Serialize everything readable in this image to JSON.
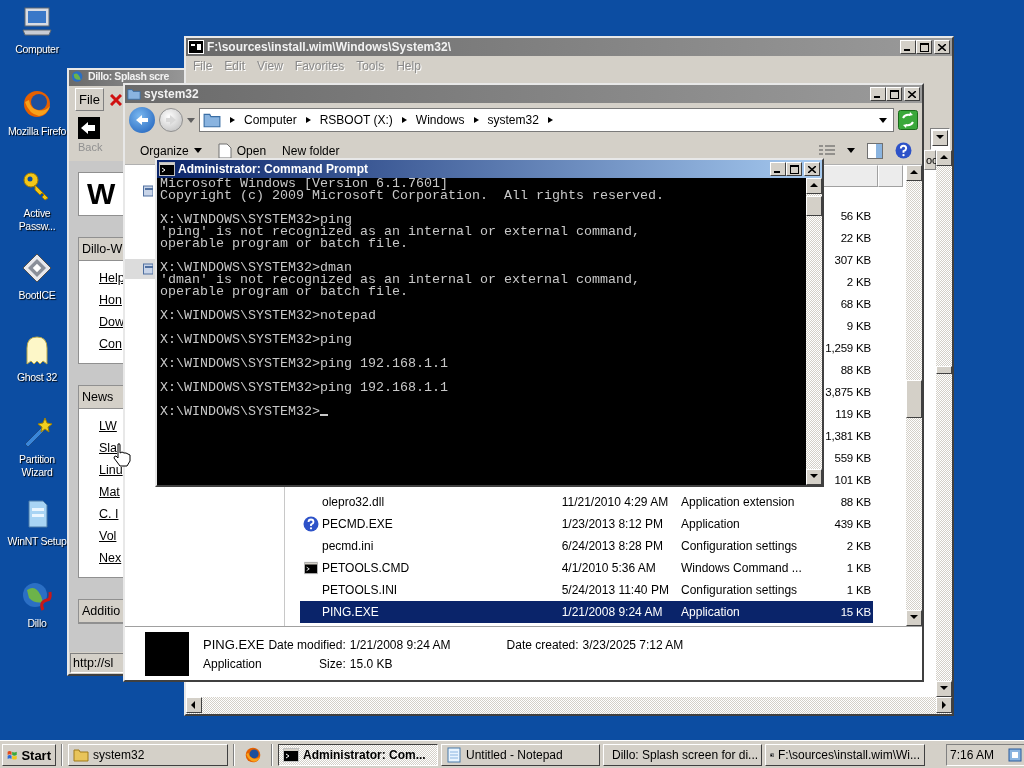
{
  "desktop_icons": [
    {
      "label": "Computer"
    },
    {
      "label": "Mozilla Firefo"
    },
    {
      "label": "Active Passw..."
    },
    {
      "label": "BootICE"
    },
    {
      "label": "Ghost 32"
    },
    {
      "label": "Partition Wizard"
    },
    {
      "label": "WinNT Setup"
    },
    {
      "label": "Dillo"
    }
  ],
  "browser_window": {
    "title": "Dillo: Splash scre",
    "active": false,
    "menu": [
      "File"
    ],
    "back_label": "Back",
    "page_heading": "W",
    "sections": [
      {
        "title": "Dillo-W",
        "links": [
          "Help",
          "Hon",
          "Dow",
          "Con"
        ]
      },
      {
        "title": "News",
        "links": [
          "LW",
          "Sla",
          "Linu",
          "Mat",
          "C. I",
          "Vol",
          "Nex"
        ]
      },
      {
        "title": "Additio"
      }
    ],
    "status": "http://sl"
  },
  "archive_window": {
    "title": "F:\\sources\\install.wim\\Windows\\System32\\",
    "active": false,
    "menu": [
      "File",
      "Edit",
      "View",
      "Favorites",
      "Tools",
      "Help"
    ],
    "columns": [
      "oc"
    ]
  },
  "explorer_window": {
    "title": "system32",
    "active": false,
    "breadcrumb": [
      "Computer",
      "RSBOOT (X:)",
      "Windows",
      "system32"
    ],
    "toolbar": [
      "Organize",
      "Open",
      "New folder"
    ],
    "files": [
      {
        "size": "56 KB",
        "selected": false
      },
      {
        "size": "22 KB",
        "selected": false
      },
      {
        "size": "307 KB",
        "selected": false
      },
      {
        "size": "2 KB",
        "selected": false
      },
      {
        "size": "68 KB",
        "selected": false
      },
      {
        "size": "9 KB",
        "selected": false
      },
      {
        "size": "1,259 KB",
        "selected": false
      },
      {
        "size": "88 KB",
        "selected": false
      },
      {
        "size": "3,875 KB",
        "selected": false
      },
      {
        "size": "119 KB",
        "selected": false
      },
      {
        "size": "1,381 KB",
        "selected": false
      },
      {
        "size": "559 KB",
        "selected": false
      },
      {
        "size": "101 KB",
        "selected": false
      },
      {
        "name": "olepro32.dll",
        "date": "11/21/2010 4:29 AM",
        "type": "Application extension",
        "size": "88 KB",
        "selected": false
      },
      {
        "name": "PECMD.EXE",
        "date": "1/23/2013 8:12 PM",
        "type": "Application",
        "size": "439 KB",
        "selected": false
      },
      {
        "name": "pecmd.ini",
        "date": "6/24/2013 8:28 PM",
        "type": "Configuration settings",
        "size": "2 KB",
        "selected": false
      },
      {
        "name": "PETOOLS.CMD",
        "date": "4/1/2010 5:36 AM",
        "type": "Windows Command ...",
        "size": "1 KB",
        "selected": false
      },
      {
        "name": "PETOOLS.INI",
        "date": "5/24/2013 11:40 PM",
        "type": "Configuration settings",
        "size": "1 KB",
        "selected": false
      },
      {
        "name": "PING.EXE",
        "date": "1/21/2008 9:24 AM",
        "type": "Application",
        "size": "15 KB",
        "selected": true
      }
    ],
    "details": {
      "name": "PING.EXE",
      "modified_label": "Date modified:",
      "modified": "1/21/2008 9:24 AM",
      "created_label": "Date created:",
      "created": "3/23/2025 7:12 AM",
      "type": "Application",
      "size_label": "Size:",
      "size": "15.0 KB"
    }
  },
  "console_window": {
    "title": "Administrator: Command Prompt",
    "active": true,
    "blocks": [
      [
        "Microsoft Windows [Version 6.1.7601]",
        "Copyright (c) 2009 Microsoft Corporation.  All rights reserved."
      ],
      [
        "X:\\WINDOWS\\SYSTEM32>ping",
        "'ping' is not recognized as an internal or external command,",
        "operable program or batch file."
      ],
      [
        "X:\\WINDOWS\\SYSTEM32>dman",
        "'dman' is not recognized as an internal or external command,",
        "operable program or batch file."
      ],
      [
        "X:\\WINDOWS\\SYSTEM32>notepad"
      ],
      [
        "X:\\WINDOWS\\SYSTEM32>ping"
      ],
      [
        "X:\\WINDOWS\\SYSTEM32>ping 192.168.1.1"
      ],
      [
        "X:\\WINDOWS\\SYSTEM32>ping 192.168.1.1"
      ],
      [
        "X:\\WINDOWS\\SYSTEM32>"
      ]
    ]
  },
  "taskbar": {
    "start": "Start",
    "buttons": [
      {
        "label": "system32",
        "selected": false
      },
      {
        "label": "Administrator: Com...",
        "selected": true
      },
      {
        "label": "Untitled - Notepad",
        "selected": false
      },
      {
        "label": "Dillo: Splash screen for di...",
        "selected": false
      },
      {
        "label": "F:\\sources\\install.wim\\Wi...",
        "selected": false
      }
    ],
    "clock": "7:16 AM"
  }
}
